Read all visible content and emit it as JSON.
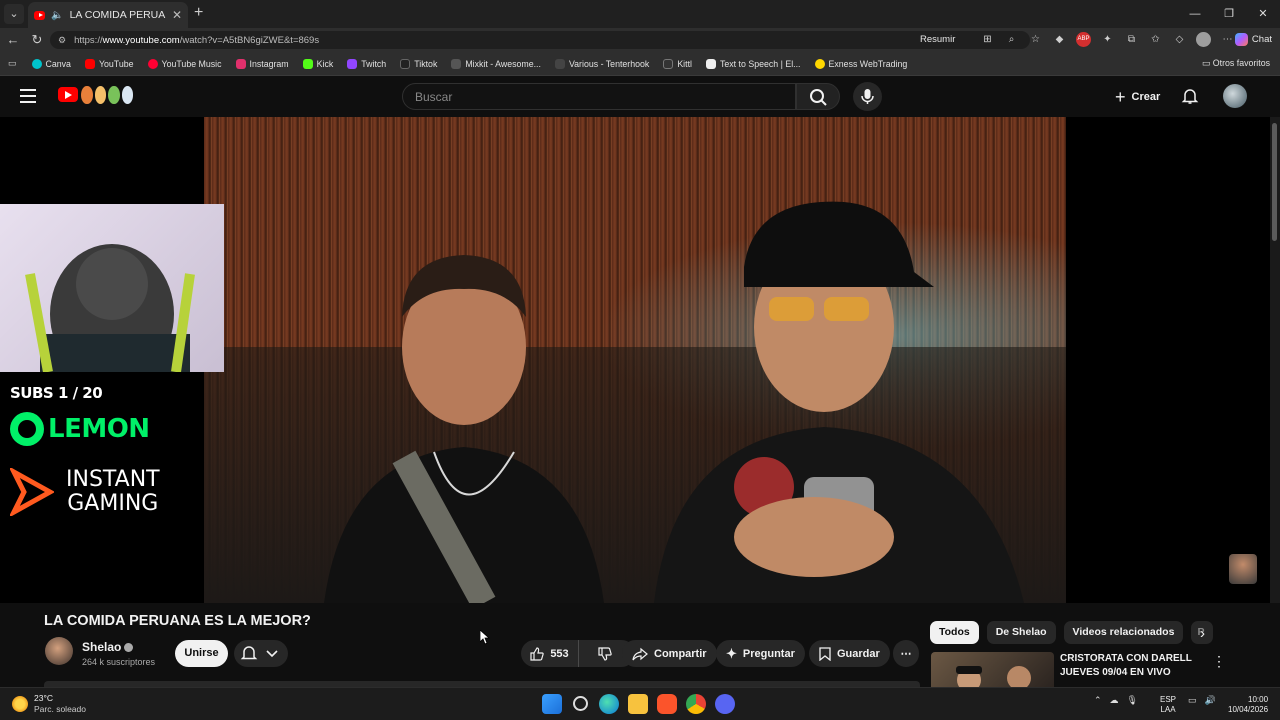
{
  "browser": {
    "tab_title": "LA COMIDA PERUANA ES LA M",
    "url_prefix": "https://",
    "url_host": "www.youtube.com",
    "url_path": "/watch?v=A5tBN6giZWE&t=869s",
    "resumir_label": "Resumir",
    "chat_label": "Chat",
    "favorites": [
      {
        "label": "Canva",
        "color": "#00c4cc"
      },
      {
        "label": "YouTube",
        "color": "#ff0000"
      },
      {
        "label": "YouTube Music",
        "color": "#ff0033"
      },
      {
        "label": "Instagram",
        "color": "#e1306c"
      },
      {
        "label": "Kick",
        "color": "#53fc18"
      },
      {
        "label": "Twitch",
        "color": "#9146ff"
      },
      {
        "label": "Tiktok",
        "color": "#222222"
      },
      {
        "label": "Mixkit - Awesome...",
        "color": "#555555"
      },
      {
        "label": "Various - Tenterhook",
        "color": "#444444"
      },
      {
        "label": "Kittl",
        "color": "#333333"
      },
      {
        "label": "Text to Speech | El...",
        "color": "#eeeeee"
      },
      {
        "label": "Exness WebTrading",
        "color": "#ffd700"
      }
    ],
    "other_favorites": "Otros favoritos"
  },
  "youtube": {
    "search_placeholder": "Buscar",
    "create_label": "Crear",
    "overlay": {
      "subs": "SUBS 1 / 20",
      "lemon": "LEMON",
      "instant": "INSTANT",
      "gaming": "GAMING"
    },
    "video_title": "LA COMIDA PERUANA ES LA MEJOR?",
    "channel_name": "Shelao",
    "channel_subs": "264 k suscriptores",
    "join_label": "Unirse",
    "likes": "553",
    "share_label": "Compartir",
    "ask_label": "Preguntar",
    "save_label": "Guardar",
    "chips": [
      "Todos",
      "De Shelao",
      "Videos relacionados",
      "P"
    ],
    "recommended_title": "CRISTORATA CON DARELL JUEVES 09/04 EN VIVO"
  },
  "taskbar": {
    "temp": "23°C",
    "weather_desc": "Parc. soleado",
    "lang_1": "ESP",
    "lang_2": "LAA",
    "time": "10:00",
    "date": "10/04/2026"
  }
}
